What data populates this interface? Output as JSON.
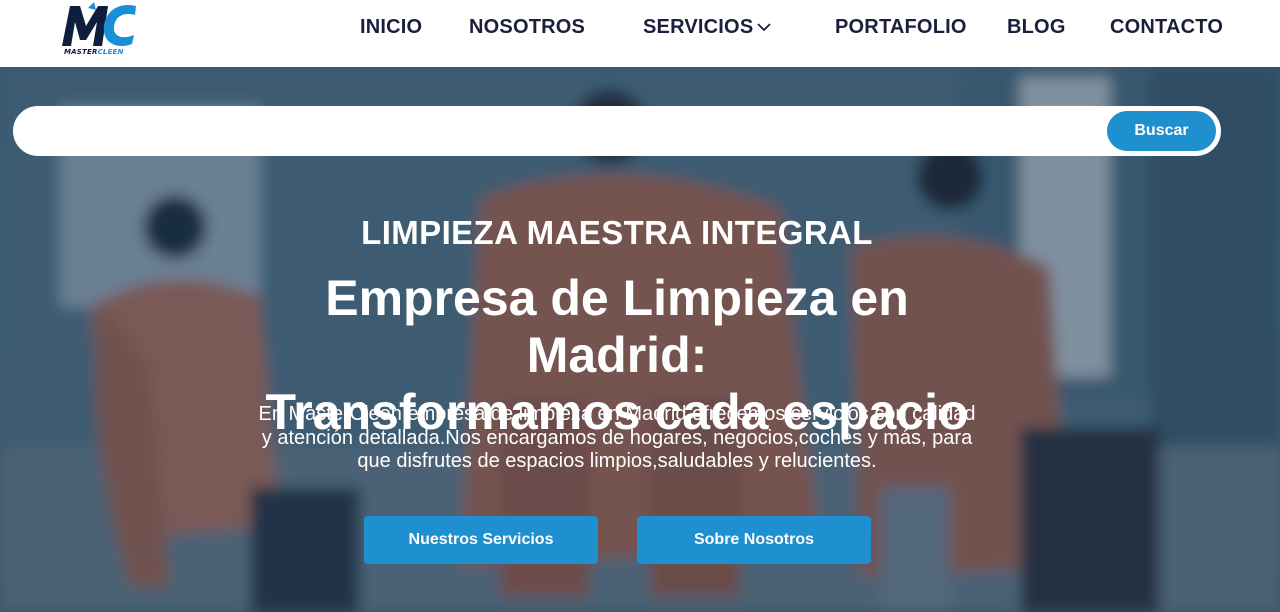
{
  "brand": {
    "logo_mark": "MC",
    "logo_text_1": "MASTER",
    "logo_text_2": "CLEEN",
    "colors": {
      "navy": "#0f1e3d",
      "blue": "#1a8fd6"
    }
  },
  "nav": {
    "items": [
      {
        "label": "INICIO"
      },
      {
        "label": "NOSOTROS"
      },
      {
        "label": "SERVICIOS",
        "icon": "chevron-down-icon"
      },
      {
        "label": "PORTAFOLIO"
      },
      {
        "label": "BLOG"
      },
      {
        "label": "CONTACTO"
      }
    ]
  },
  "search": {
    "value": "",
    "placeholder": "",
    "button_label": "Buscar"
  },
  "hero": {
    "eyebrow": "LIMPIEZA MAESTRA INTEGRAL",
    "title_line1": "Empresa de Limpieza en Madrid:",
    "title_line2": "Transformamos cada espacio",
    "description_line1": "En MasterCleen,empresa de limpieza en Madrid,ofrecemos servicios con calidad",
    "description_line2": "y atención detallada.Nos encargamos de hogares, negocios,coches y más, para",
    "description_line3": "que disfrutes de espacios limpios,saludables y relucientes.",
    "buttons": {
      "services": "Nuestros Servicios",
      "about": "Sobre Nosotros"
    }
  },
  "colors": {
    "accent": "#1e90cf",
    "nav_text": "#1b1f3b",
    "overlay": "#162e4a"
  }
}
